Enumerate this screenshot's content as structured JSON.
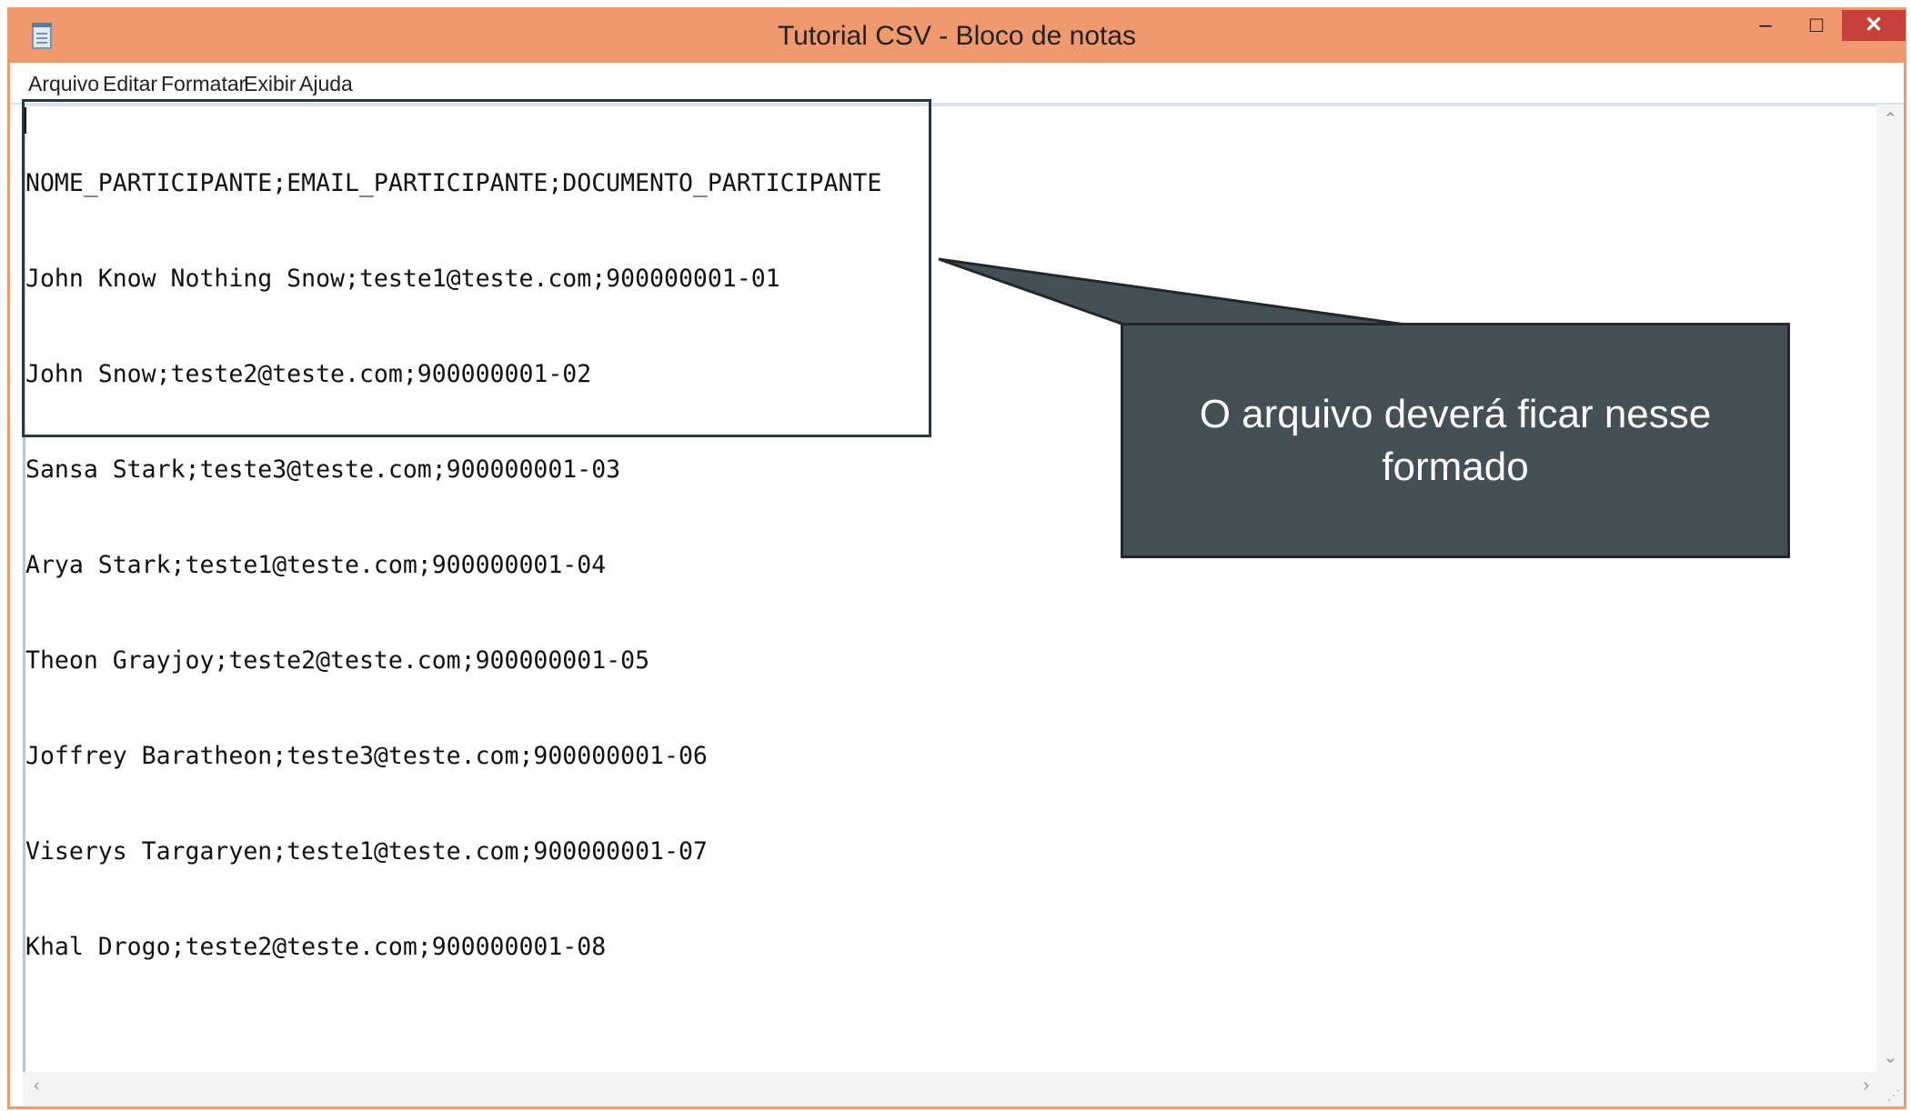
{
  "window": {
    "title": "Tutorial CSV - Bloco de notas",
    "controls": {
      "minimize": "–",
      "maximize": "□",
      "close": "✕"
    }
  },
  "menu": [
    "Arquivo",
    "Editar",
    "Formatar",
    "Exibir",
    "Ajuda"
  ],
  "editor": {
    "lines": [
      "NOME_PARTICIPANTE;EMAIL_PARTICIPANTE;DOCUMENTO_PARTICIPANTE",
      "John Know Nothing Snow;teste1@teste.com;900000001-01",
      "John Snow;teste2@teste.com;900000001-02",
      "Sansa Stark;teste3@teste.com;900000001-03",
      "Arya Stark;teste1@teste.com;900000001-04",
      "Theon Grayjoy;teste2@teste.com;900000001-05",
      "Joffrey Baratheon;teste3@teste.com;900000001-06",
      "Viserys Targaryen;teste1@teste.com;900000001-07",
      "Khal Drogo;teste2@teste.com;900000001-08"
    ]
  },
  "callout": {
    "text": "O arquivo deverá ficar nesse formado"
  },
  "scrollbars": {
    "up": "⌃",
    "down": "⌄",
    "left": "‹",
    "right": "›",
    "grip": "⋰"
  },
  "colors": {
    "titlebar": "#f0996f",
    "close_button": "#c8403a",
    "callout_background": "#455056",
    "box_border": "#273746"
  }
}
